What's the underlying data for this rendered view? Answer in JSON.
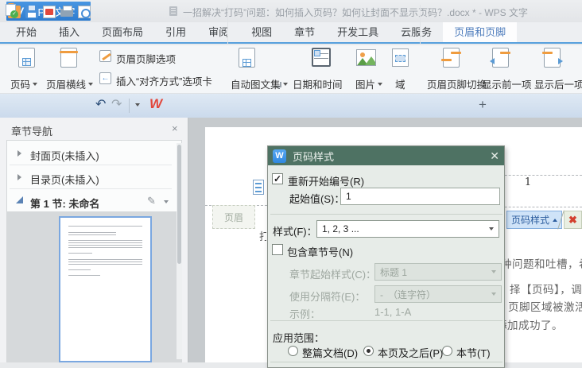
{
  "window": {
    "app_button": "WPS 文字",
    "title": "一招解决“打码”问题：如何插入页码？如何让封面不显示页码？.docx * - WPS 文字"
  },
  "ribbon": {
    "tabs": [
      {
        "label": "开始"
      },
      {
        "label": "插入"
      },
      {
        "label": "页面布局"
      },
      {
        "label": "引用"
      },
      {
        "label": "审阅"
      },
      {
        "label": "视图"
      },
      {
        "label": "章节"
      },
      {
        "label": "开发工具"
      },
      {
        "label": "云服务"
      },
      {
        "label": "页眉和页脚",
        "active": true
      }
    ],
    "buttons": {
      "page_number": "页码",
      "header_line": "页眉横线",
      "header_footer_options": "页眉页脚选项",
      "insert_align_tab": "插入“对齐方式”选项卡",
      "autotext": "自动图文集",
      "datetime": "日期和时间",
      "picture": "图片",
      "field": "域",
      "toggle_header_footer": "页眉页脚切换",
      "show_prev": "显示前一项",
      "show_next": "显示后一项"
    }
  },
  "quickbar": {
    "doc_tab_title": "一招解决“打码”问题：如何插入页码？如何让封面不显示页码？.docx *",
    "doc_tab_close": "×",
    "new_tab": "+"
  },
  "sidebar": {
    "title": "章节导航",
    "close": "×",
    "items": [
      {
        "label": "封面页(未插入)"
      },
      {
        "label": "目录页(未插入)"
      },
      {
        "label": "第 1 节: 未命名"
      }
    ]
  },
  "document": {
    "header_tag": "页眉",
    "page_number": "1",
    "page_number_style_button": "页码样式",
    "delete_icon_glyph": "✖",
    "fragments": [
      "种问题和吐槽，希",
      "择【页码】，调出",
      "页脚区域被激活，",
      "添加成功了。",
      "打"
    ]
  },
  "dialog": {
    "title": "页码样式",
    "close": "✕",
    "restart_label": "重新开始编号(R)",
    "restart_checked": true,
    "start_label": "起始值(S)：",
    "start_value": "1",
    "style_label": "样式(F)：",
    "style_value": "1, 2, 3 ...",
    "include_chapter_label": "包含章节号(N)",
    "include_chapter_checked": false,
    "chapter_style_label": "章节起始样式(C)：",
    "chapter_style_value": "标题 1",
    "separator_label": "使用分隔符(E)：",
    "separator_value": "-　（连字符）",
    "example_label": "示例：",
    "example_value": "1-1, 1-A",
    "scope_label": "应用范围：",
    "radios": [
      {
        "label": "整篇文档(D)",
        "selected": false
      },
      {
        "label": "本页及之后(P)",
        "selected": true
      },
      {
        "label": "本节(T)",
        "selected": false
      }
    ]
  },
  "colors": {
    "dialog_title_bg": "#4e7263",
    "accent_blue": "#5b9bd5",
    "active_tab_text": "#4f7dbd",
    "highlight_button_bg": "#cfe3f8",
    "delete_red": "#d3402e",
    "icon_orange": "#ef9c3f"
  }
}
